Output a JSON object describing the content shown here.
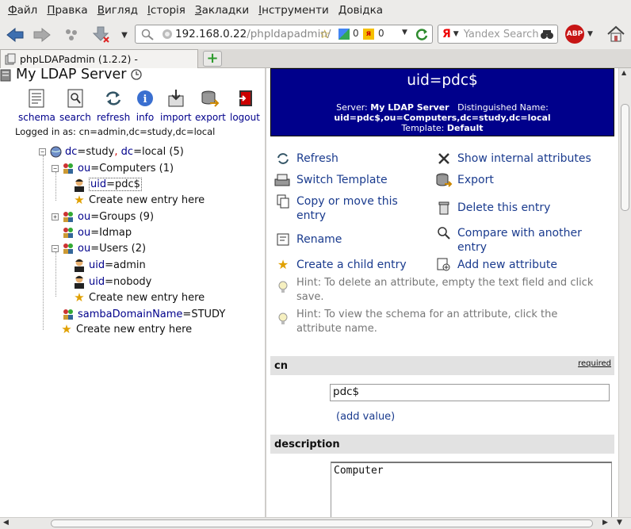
{
  "menu": [
    "Файл",
    "Правка",
    "Вигляд",
    "Історія",
    "Закладки",
    "Інструменти",
    "Довідка"
  ],
  "menu_access": [
    "Ф",
    "П",
    "В",
    "І",
    "З",
    "І",
    "Д"
  ],
  "browser": {
    "url_host": "192.168.0.22",
    "url_path": "/phpldapadmin/",
    "badge_a": "0",
    "badge_b": "0",
    "search_engine": "Я",
    "search_placeholder": "Yandex Search",
    "adblock": "ABP",
    "tab_title": "phpLDAPadmin (1.2.2) -"
  },
  "left": {
    "server_title": "My LDAP Server",
    "toolbar": [
      "schema",
      "search",
      "refresh",
      "info",
      "import",
      "export",
      "logout"
    ],
    "logged_in": "Logged in as: cn=admin,dc=study,dc=local",
    "tree": {
      "root": {
        "k1": "dc",
        "v1": "study",
        "sep": ",",
        "k2": "dc",
        "v2": "local",
        "count": "(5)"
      },
      "computers": {
        "k": "ou",
        "v": "Computers",
        "count": "(1)"
      },
      "pdc": {
        "k": "uid",
        "v": "pdc$"
      },
      "create1": "Create new entry here",
      "groups": {
        "k": "ou",
        "v": "Groups",
        "count": "(9)"
      },
      "idmap": {
        "k": "ou",
        "v": "Idmap"
      },
      "users": {
        "k": "ou",
        "v": "Users",
        "count": "(2)"
      },
      "admin": {
        "k": "uid",
        "v": "admin"
      },
      "nobody": {
        "k": "uid",
        "v": "nobody"
      },
      "create2": "Create new entry here",
      "samba": {
        "k": "sambaDomainName",
        "v": "STUDY"
      },
      "create3": "Create new entry here"
    }
  },
  "right": {
    "header_title": "uid=pdc$",
    "server_label": "Server:",
    "server_value": "My LDAP Server",
    "dn_label": "Distinguished Name:",
    "dn_value": "uid=pdc$,ou=Computers,dc=study,dc=local",
    "template_label": "Template:",
    "template_value": "Default",
    "actions": {
      "refresh": "Refresh",
      "show_internal": "Show internal attributes",
      "switch_template": "Switch Template",
      "export": "Export",
      "copy_move_1": "Copy or move this",
      "copy_move_2": "entry",
      "delete": "Delete this entry",
      "rename": "Rename",
      "compare_1": "Compare with another",
      "compare_2": "entry",
      "create_child": "Create a child entry",
      "add_attribute": "Add new attribute"
    },
    "hint1_a": "Hint: To delete an attribute, empty the text field and click",
    "hint1_b": "save.",
    "hint2_a": "Hint: To view the schema for an attribute, click the",
    "hint2_b": "attribute name.",
    "attr_cn": "cn",
    "required": "required",
    "cn_value": "pdc$",
    "add_value": "(add value)",
    "attr_description": "description",
    "description_value": "Computer"
  },
  "colors": {
    "header_bg": "#00008b",
    "link": "#1a3b8e",
    "attr_bar": "#e2e2e2"
  }
}
